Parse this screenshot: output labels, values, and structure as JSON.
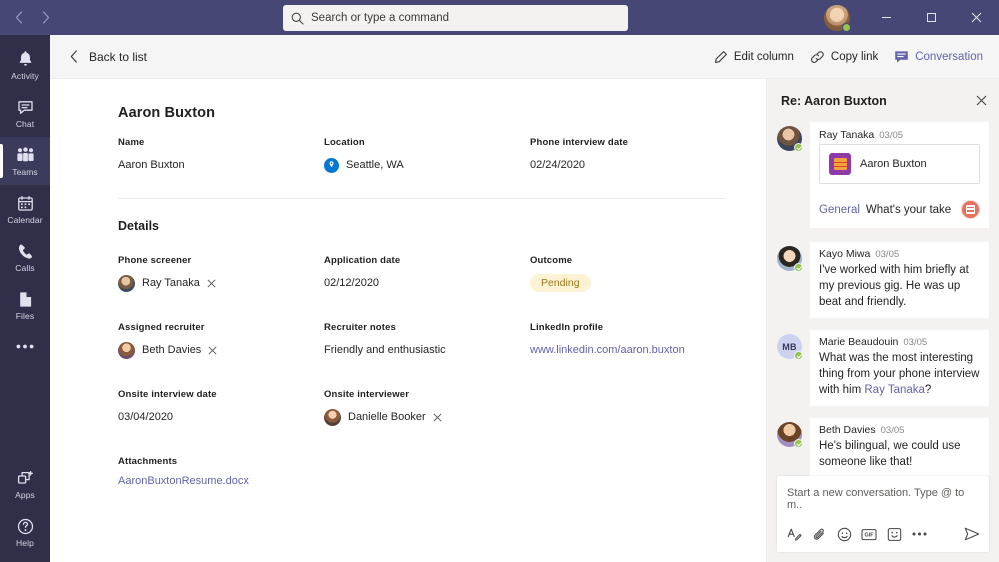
{
  "titlebar": {
    "back_icon": "chevron-left-icon",
    "forward_icon": "chevron-right-icon",
    "search_placeholder": "Search or type a command",
    "minimize_label": "Minimize",
    "maximize_label": "Maximize",
    "close_label": "Close"
  },
  "rail": {
    "items": [
      {
        "label": "Activity",
        "icon": "bell-icon",
        "active": false
      },
      {
        "label": "Chat",
        "icon": "chat-icon",
        "active": false
      },
      {
        "label": "Teams",
        "icon": "teams-icon",
        "active": true
      },
      {
        "label": "Calendar",
        "icon": "calendar-icon",
        "active": false
      },
      {
        "label": "Calls",
        "icon": "phone-icon",
        "active": false
      },
      {
        "label": "Files",
        "icon": "file-icon",
        "active": false
      }
    ],
    "more_label": "More options",
    "bottom": [
      {
        "label": "Apps",
        "icon": "apps-icon"
      },
      {
        "label": "Help",
        "icon": "help-icon"
      }
    ]
  },
  "toolbar": {
    "back_label": "Back to list",
    "edit_column_label": "Edit column",
    "copy_link_label": "Copy link",
    "conversation_label": "Conversation"
  },
  "record": {
    "title": "Aaron Buxton",
    "top_fields": [
      {
        "label": "Name",
        "value": "Aaron Buxton",
        "type": "text"
      },
      {
        "label": "Location",
        "value": "Seattle, WA",
        "type": "location"
      },
      {
        "label": "Phone interview date",
        "value": "02/24/2020",
        "type": "text"
      }
    ],
    "details_heading": "Details",
    "details_row1": [
      {
        "label": "Phone screener",
        "value": "Ray Tanaka",
        "type": "person"
      },
      {
        "label": "Application date",
        "value": "02/12/2020",
        "type": "text"
      },
      {
        "label": "Outcome",
        "value": "Pending",
        "type": "pill"
      }
    ],
    "details_row2": [
      {
        "label": "Assigned recruiter",
        "value": "Beth Davies",
        "type": "person"
      },
      {
        "label": "Recruiter notes",
        "value": "Friendly and enthusiastic",
        "type": "text"
      },
      {
        "label": "LinkedIn profile",
        "value": "www.linkedin.com/aaron.buxton",
        "type": "link"
      }
    ],
    "details_row3": [
      {
        "label": "Onsite interview date",
        "value": "03/04/2020",
        "type": "text"
      },
      {
        "label": "Onsite interviewer",
        "value": "Danielle Booker",
        "type": "person"
      }
    ],
    "attachments_label": "Attachments",
    "attachment_file": "AaronBuxtonResume.docx"
  },
  "conversation": {
    "title": "Re: Aaron Buxton",
    "close_icon": "close-icon",
    "messages": [
      {
        "author": "Ray Tanaka",
        "time": "03/05",
        "type": "card",
        "card_title": "Aaron Buxton",
        "card_icon": "lists-app-icon",
        "footer_channel": "General",
        "footer_text": "What's your take",
        "footer_badge": "lists-badge-icon"
      },
      {
        "author": "Kayo Miwa",
        "time": "03/05",
        "type": "text",
        "text": "I've worked with him briefly at my previous gig. He was up beat and friendly."
      },
      {
        "author": "Marie Beaudouin",
        "time": "03/05",
        "type": "mention",
        "text_before": "What was the most interesting thing from your phone interview with him ",
        "mention": "Ray Tanaka",
        "text_after": "?",
        "initials": "MB"
      },
      {
        "author": "Beth Davies",
        "time": "03/05",
        "type": "text",
        "text": "He's bilingual, we could use someone like that!"
      }
    ],
    "compose": {
      "placeholder": "Start a new conversation. Type @ to m..",
      "actions": [
        {
          "icon": "format-icon",
          "label": "Format"
        },
        {
          "icon": "attach-icon",
          "label": "Attach"
        },
        {
          "icon": "emoji-icon",
          "label": "Emoji"
        },
        {
          "icon": "gif-icon",
          "label": "GIF"
        },
        {
          "icon": "sticker-icon",
          "label": "Sticker"
        },
        {
          "icon": "more-icon",
          "label": "More options"
        }
      ],
      "send_icon": "send-icon"
    }
  },
  "colors": {
    "brand_purple": "#6264a7",
    "titlebar": "#464775",
    "rail": "#2f2f4a",
    "panel_bg": "#f3f2f1",
    "pill_bg": "#fdf3d4",
    "pill_text": "#9a7b18",
    "presence_green": "#92c353",
    "location_blue": "#0078d4"
  }
}
